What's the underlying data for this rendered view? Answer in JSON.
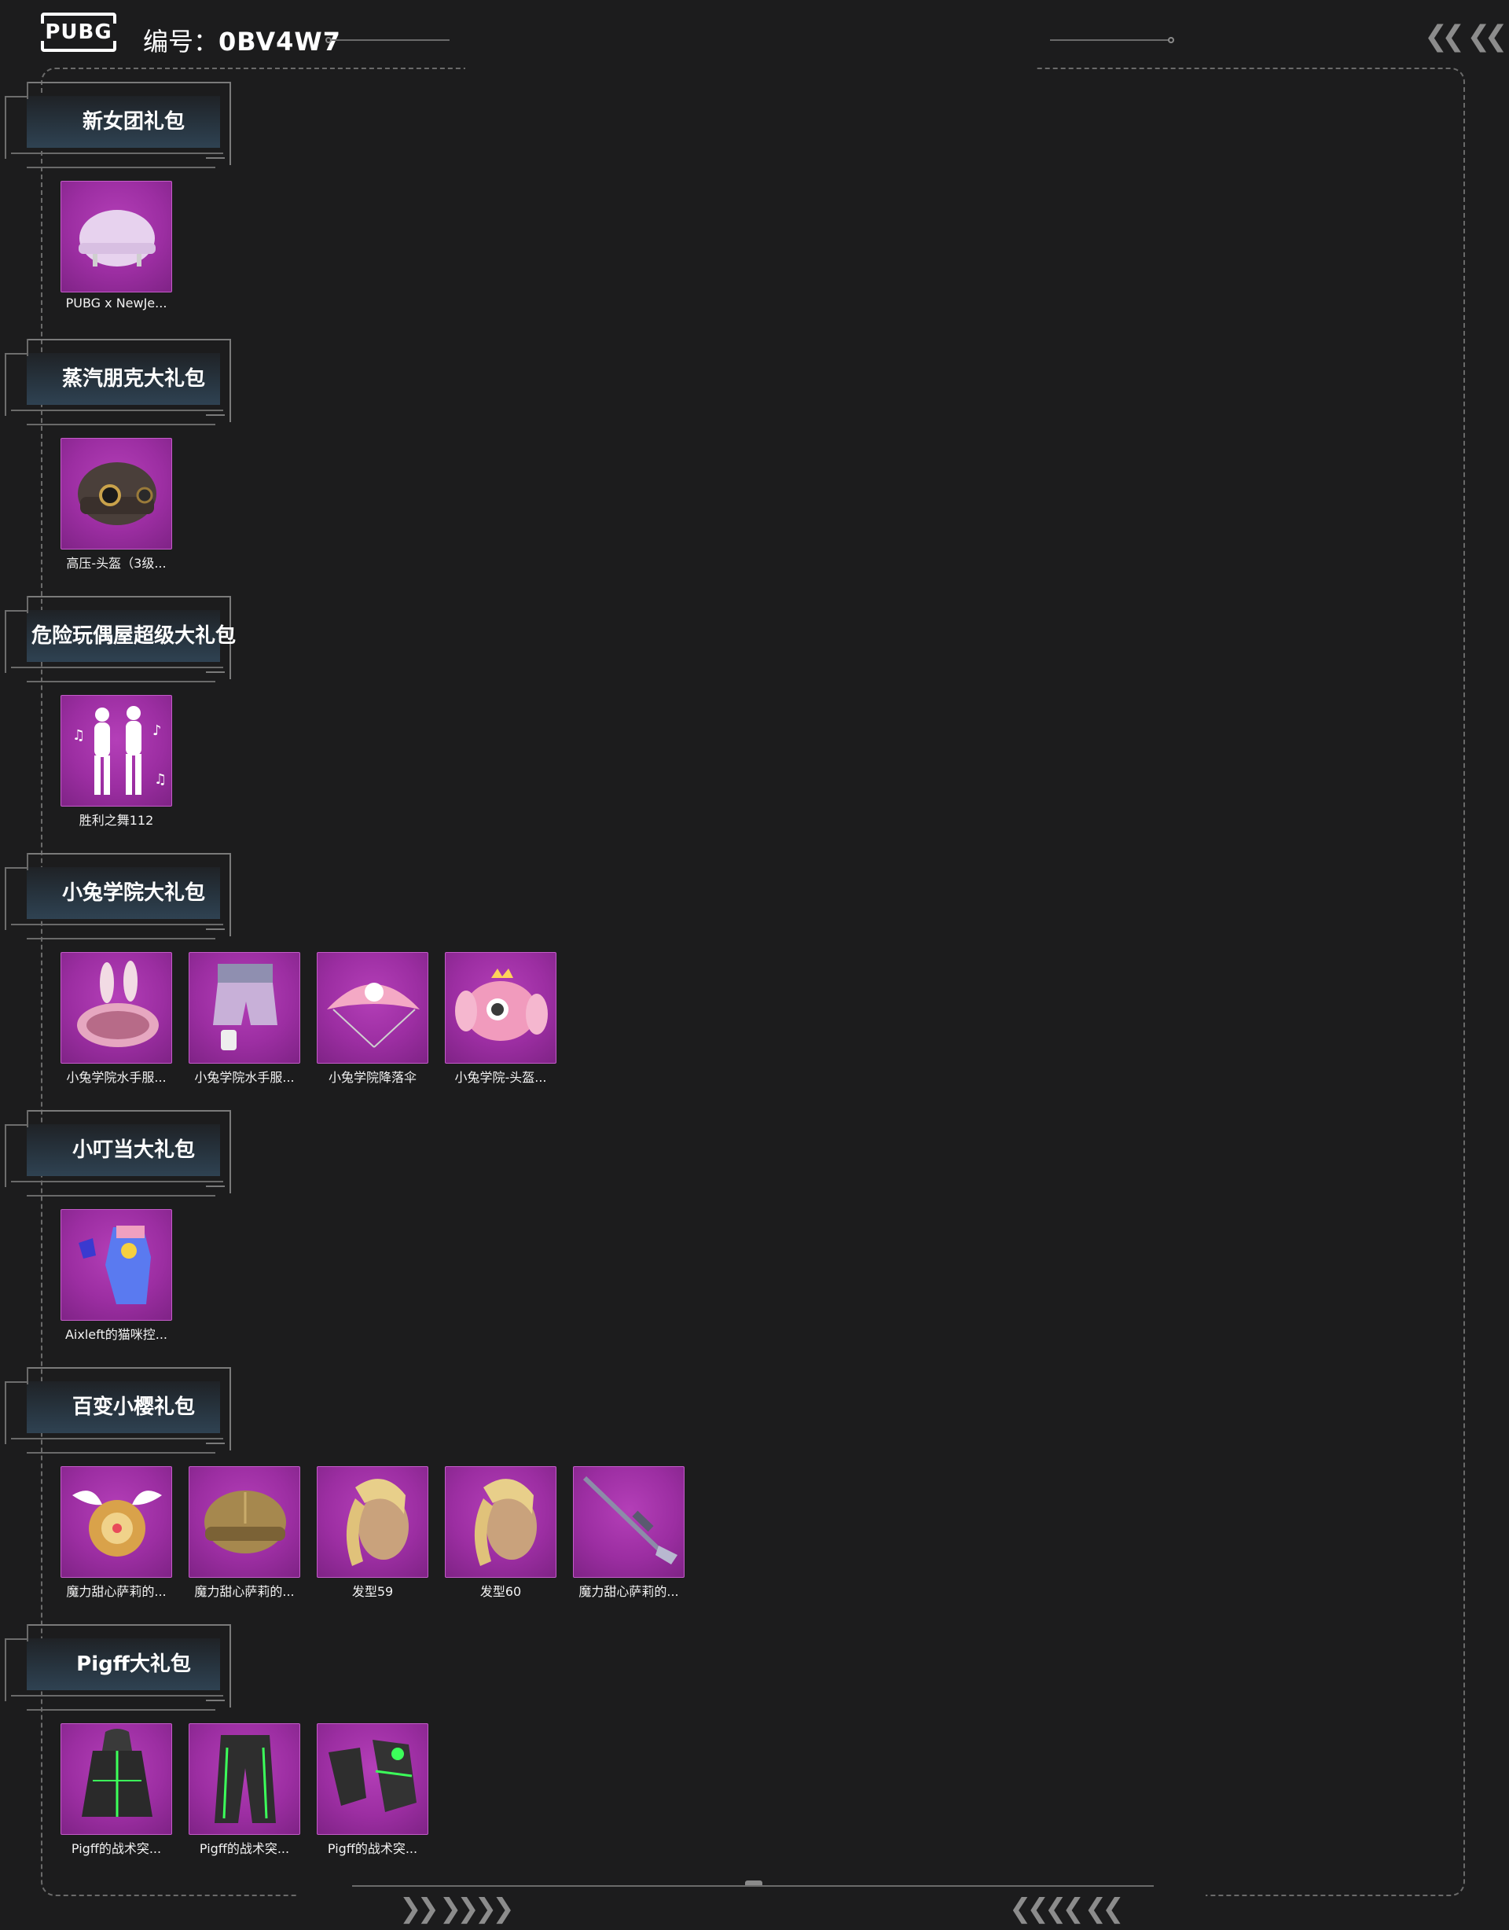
{
  "header": {
    "logo": "PUBG",
    "serial_label": "编号：",
    "serial_value": "0BV4W7"
  },
  "sections": [
    {
      "title": "新女团礼包",
      "items": [
        {
          "label": "PUBG x NewJe...",
          "icon": "helmet-icon"
        }
      ]
    },
    {
      "title": "蒸汽朋克大礼包",
      "items": [
        {
          "label": "高压-头盔（3级...",
          "icon": "steampunk-helmet-icon"
        }
      ]
    },
    {
      "title": "危险玩偶屋超级大礼包",
      "items": [
        {
          "label": "胜利之舞112",
          "icon": "dance-emote-icon"
        }
      ]
    },
    {
      "title": "小兔学院大礼包",
      "items": [
        {
          "label": "小兔学院水手服...",
          "icon": "bunny-backpack-icon"
        },
        {
          "label": "小兔学院水手服...",
          "icon": "shorts-icon"
        },
        {
          "label": "小兔学院降落伞",
          "icon": "parachute-icon"
        },
        {
          "label": "小兔学院-头盔...",
          "icon": "bunny-helmet-icon"
        }
      ]
    },
    {
      "title": "小叮当大礼包",
      "items": [
        {
          "label": "Aixleft的猫咪控...",
          "icon": "gloves-icon"
        }
      ]
    },
    {
      "title": "百变小樱礼包",
      "items": [
        {
          "label": "魔力甜心萨莉的...",
          "icon": "winged-backpack-icon"
        },
        {
          "label": "魔力甜心萨莉的...",
          "icon": "gold-helmet-icon"
        },
        {
          "label": "发型59",
          "icon": "hairstyle-icon"
        },
        {
          "label": "发型60",
          "icon": "hairstyle-icon"
        },
        {
          "label": "魔力甜心萨莉的...",
          "icon": "rifle-icon"
        }
      ]
    },
    {
      "title": "Pigff大礼包",
      "items": [
        {
          "label": "Pigff的战术突...",
          "icon": "hooded-jacket-icon"
        },
        {
          "label": "Pigff的战术突...",
          "icon": "tactical-pants-icon"
        },
        {
          "label": "Pigff的战术突...",
          "icon": "tactical-gloves-icon"
        }
      ]
    }
  ]
}
